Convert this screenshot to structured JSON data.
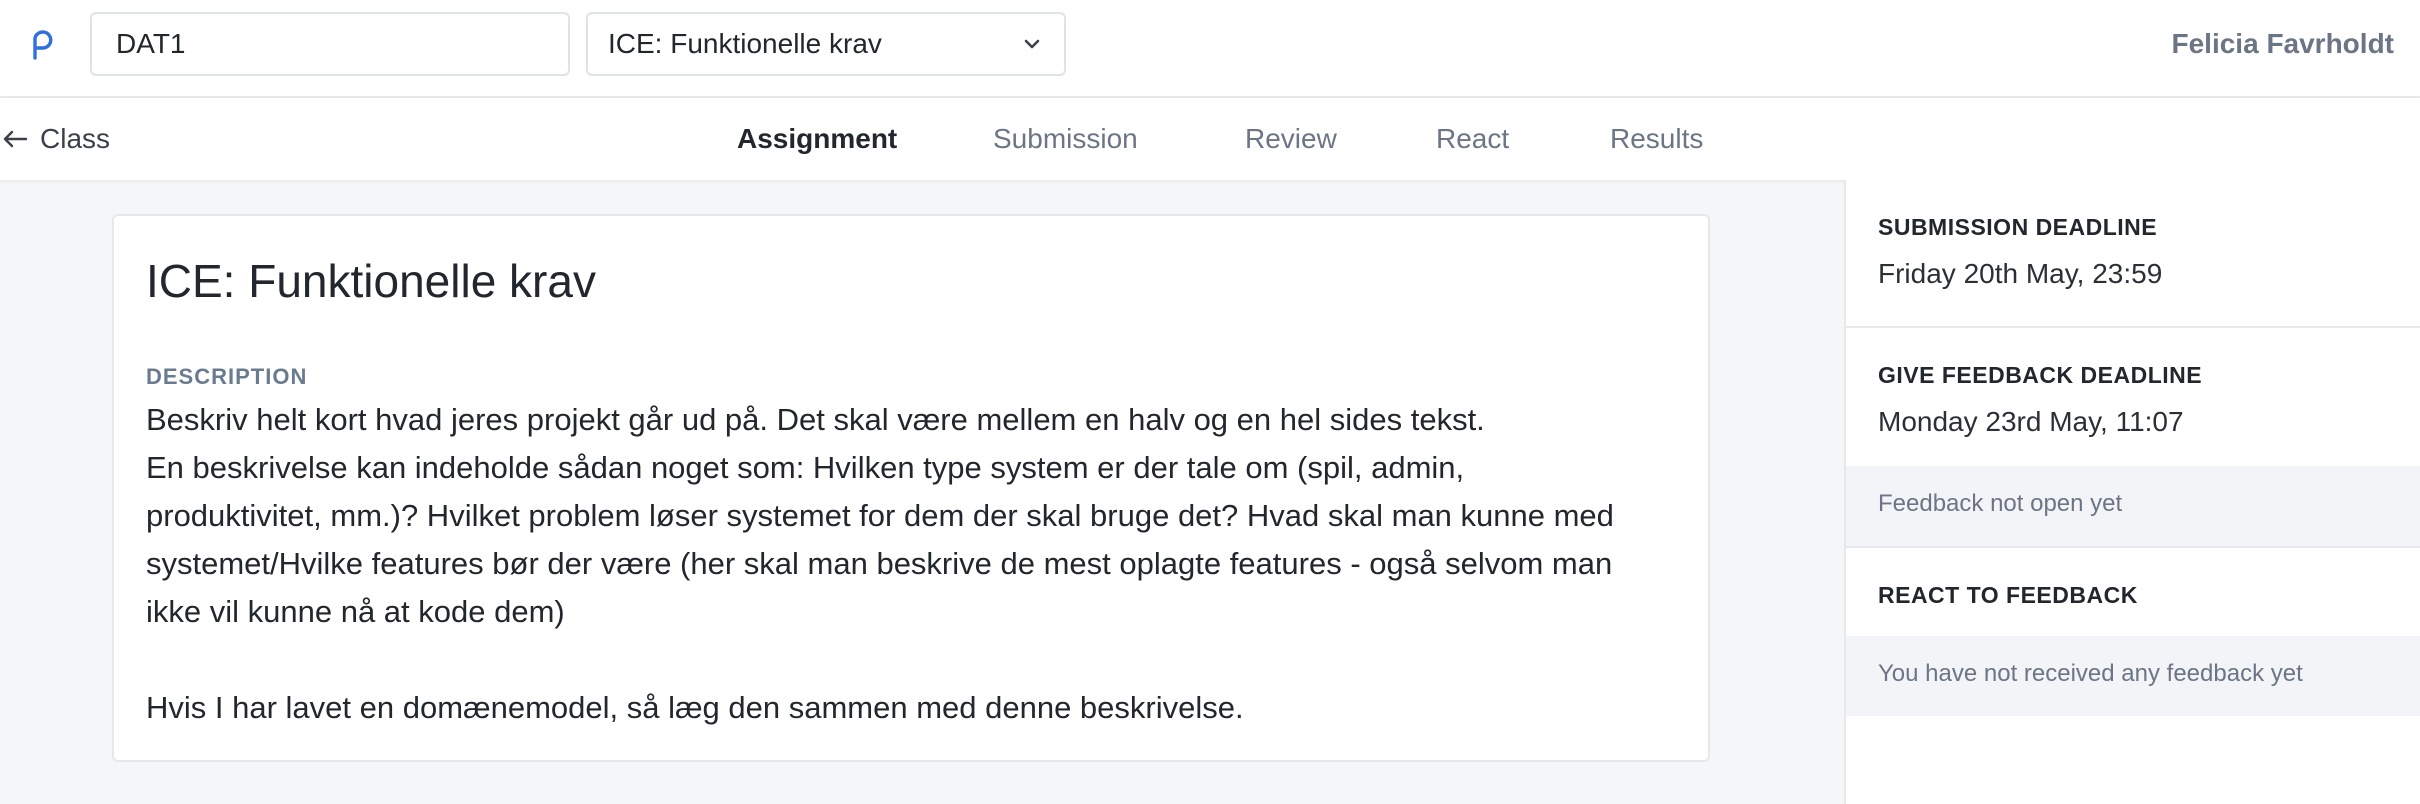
{
  "header": {
    "course_code": "DAT1",
    "assignment_selected": "ICE: Funktionelle krav",
    "user_name": "Felicia Favrholdt",
    "logo_icon": "p-logo-icon",
    "accent_color": "#2f6fe0"
  },
  "nav": {
    "back_label": "Class",
    "tabs": [
      {
        "label": "Assignment",
        "active": true
      },
      {
        "label": "Submission",
        "active": false
      },
      {
        "label": "Review",
        "active": false
      },
      {
        "label": "React",
        "active": false
      },
      {
        "label": "Results",
        "active": false
      }
    ]
  },
  "assignment": {
    "title": "ICE: Funktionelle krav",
    "description_label": "DESCRIPTION",
    "description_lines": [
      "Beskriv helt kort hvad jeres projekt går ud på. Det skal være mellem en halv og en hel sides tekst.",
      "En beskrivelse kan indeholde sådan noget som: Hvilken type system er der tale om (spil, admin, produktivitet, mm.)? Hvilket problem løser systemet for dem der skal bruge det? Hvad skal man kunne med systemet/Hvilke features bør der være (her skal man beskrive de mest oplagte features - også selvom man ikke vil kunne nå at kode dem)",
      "Hvis I har lavet en domænemodel, så læg den sammen med denne beskrivelse."
    ]
  },
  "sidebar": {
    "submission_deadline_label": "SUBMISSION DEADLINE",
    "submission_deadline_value": "Friday 20th May, 23:59",
    "feedback_deadline_label": "GIVE FEEDBACK DEADLINE",
    "feedback_deadline_value": "Monday 23rd May, 11:07",
    "feedback_note": "Feedback not open yet",
    "react_label": "REACT TO FEEDBACK",
    "react_note": "You have not received any feedback yet"
  }
}
